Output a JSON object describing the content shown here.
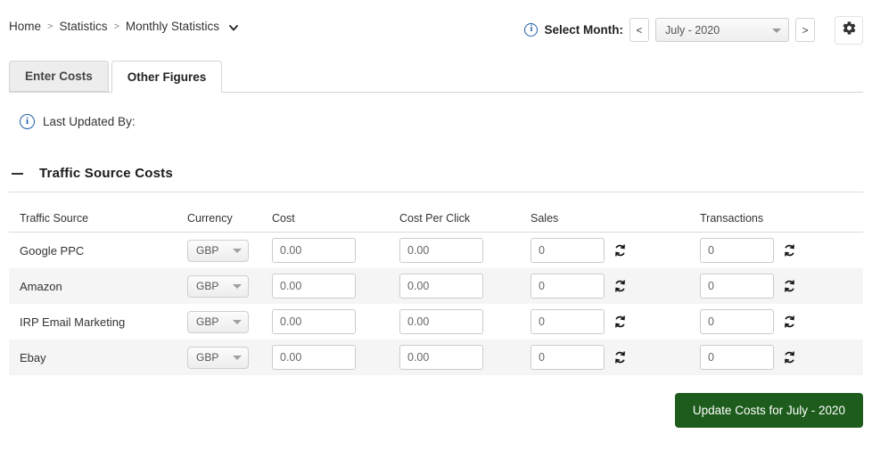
{
  "breadcrumb": {
    "items": [
      "Home",
      "Statistics",
      "Monthly Statistics"
    ],
    "separator": ">",
    "caret_icon": "chevron-down-icon"
  },
  "header": {
    "info_icon": "info-icon",
    "select_month_label": "Select Month:",
    "prev_label": "<",
    "next_label": ">",
    "selected_month": "July - 2020",
    "gear_icon": "gear-icon"
  },
  "tabs": [
    {
      "label": "Enter Costs",
      "active": false
    },
    {
      "label": "Other Figures",
      "active": true
    }
  ],
  "last_updated": {
    "info_icon": "info-icon",
    "label": "Last Updated By:",
    "value": ""
  },
  "section": {
    "collapse_icon": "minus-icon",
    "title": "Traffic Source Costs"
  },
  "table": {
    "columns": [
      "Traffic Source",
      "Currency",
      "Cost",
      "Cost Per Click",
      "Sales",
      "Transactions"
    ],
    "refresh_icon": "refresh-icon",
    "rows": [
      {
        "source": "Google PPC",
        "currency": "GBP",
        "cost": "0.00",
        "cost_per_click": "0.00",
        "sales": "0",
        "transactions": "0"
      },
      {
        "source": "Amazon",
        "currency": "GBP",
        "cost": "0.00",
        "cost_per_click": "0.00",
        "sales": "0",
        "transactions": "0"
      },
      {
        "source": "IRP Email Marketing",
        "currency": "GBP",
        "cost": "0.00",
        "cost_per_click": "0.00",
        "sales": "0",
        "transactions": "0"
      },
      {
        "source": "Ebay",
        "currency": "GBP",
        "cost": "0.00",
        "cost_per_click": "0.00",
        "sales": "0",
        "transactions": "0"
      }
    ]
  },
  "footer": {
    "update_label": "Update Costs for July - 2020",
    "update_color": "#1d5c1d"
  }
}
